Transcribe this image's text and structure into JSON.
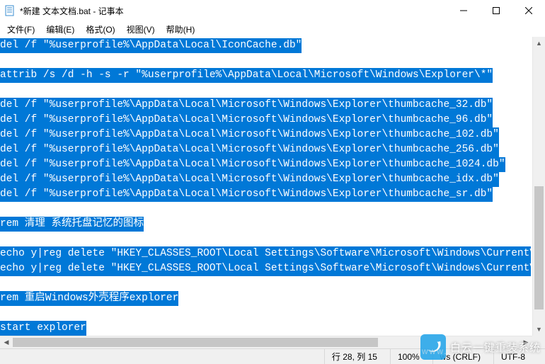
{
  "title": "*新建 文本文档.bat - 记事本",
  "menus": {
    "file": "文件(F)",
    "edit": "编辑(E)",
    "format": "格式(O)",
    "view": "视图(V)",
    "help": "帮助(H)"
  },
  "lines": [
    "del /f \"%userprofile%\\AppData\\Local\\IconCache.db\"",
    "",
    "attrib /s /d -h -s -r \"%userprofile%\\AppData\\Local\\Microsoft\\Windows\\Explorer\\*\"",
    "",
    "del /f \"%userprofile%\\AppData\\Local\\Microsoft\\Windows\\Explorer\\thumbcache_32.db\"",
    "del /f \"%userprofile%\\AppData\\Local\\Microsoft\\Windows\\Explorer\\thumbcache_96.db\"",
    "del /f \"%userprofile%\\AppData\\Local\\Microsoft\\Windows\\Explorer\\thumbcache_102.db\"",
    "del /f \"%userprofile%\\AppData\\Local\\Microsoft\\Windows\\Explorer\\thumbcache_256.db\"",
    "del /f \"%userprofile%\\AppData\\Local\\Microsoft\\Windows\\Explorer\\thumbcache_1024.db\"",
    "del /f \"%userprofile%\\AppData\\Local\\Microsoft\\Windows\\Explorer\\thumbcache_idx.db\"",
    "del /f \"%userprofile%\\AppData\\Local\\Microsoft\\Windows\\Explorer\\thumbcache_sr.db\"",
    "",
    "rem 清理 系统托盘记忆的图标",
    "",
    "echo y|reg delete \"HKEY_CLASSES_ROOT\\Local Settings\\Software\\Microsoft\\Windows\\CurrentV",
    "echo y|reg delete \"HKEY_CLASSES_ROOT\\Local Settings\\Software\\Microsoft\\Windows\\CurrentV",
    "",
    "rem 重启Windows外壳程序explorer",
    "",
    "start explorer"
  ],
  "status": {
    "position": "行 28, 列 15",
    "zoom": "100%",
    "eol": "ws (CRLF)",
    "encoding": "UTF-8"
  },
  "watermark": {
    "cn": "白云一键重装系统",
    "en": "www.baiyunxitong.com"
  }
}
